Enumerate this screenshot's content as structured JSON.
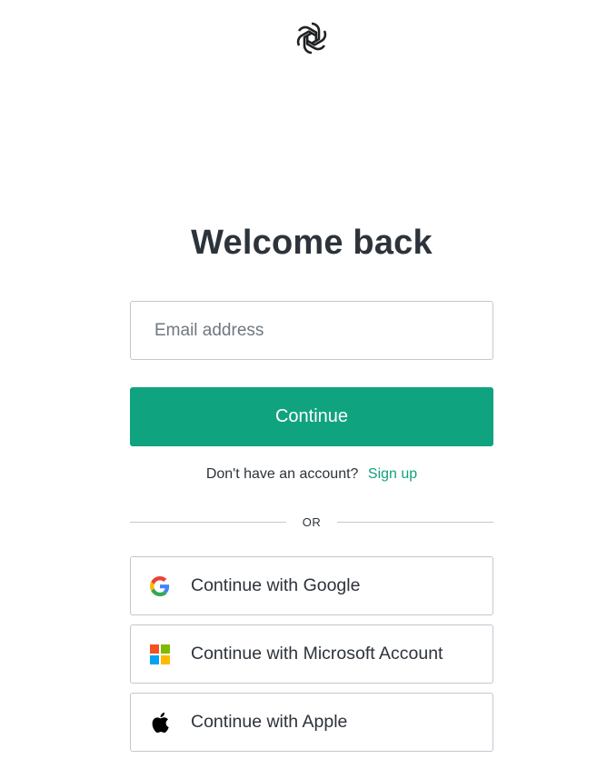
{
  "logo": {
    "icon": "openai-logo-icon"
  },
  "heading": "Welcome back",
  "email_field": {
    "placeholder": "Email address",
    "value": ""
  },
  "continue_button": {
    "label": "Continue",
    "color": "#10a37f"
  },
  "signup": {
    "prompt": "Don't have an account?",
    "link_label": "Sign up"
  },
  "divider": {
    "label": "OR"
  },
  "social_buttons": [
    {
      "label": "Continue with Google",
      "icon": "google-icon"
    },
    {
      "label": "Continue with Microsoft Account",
      "icon": "microsoft-icon"
    },
    {
      "label": "Continue with Apple",
      "icon": "apple-icon"
    }
  ],
  "colors": {
    "text": "#2d333a",
    "border": "#c2c8d0",
    "accent": "#10a37f"
  }
}
